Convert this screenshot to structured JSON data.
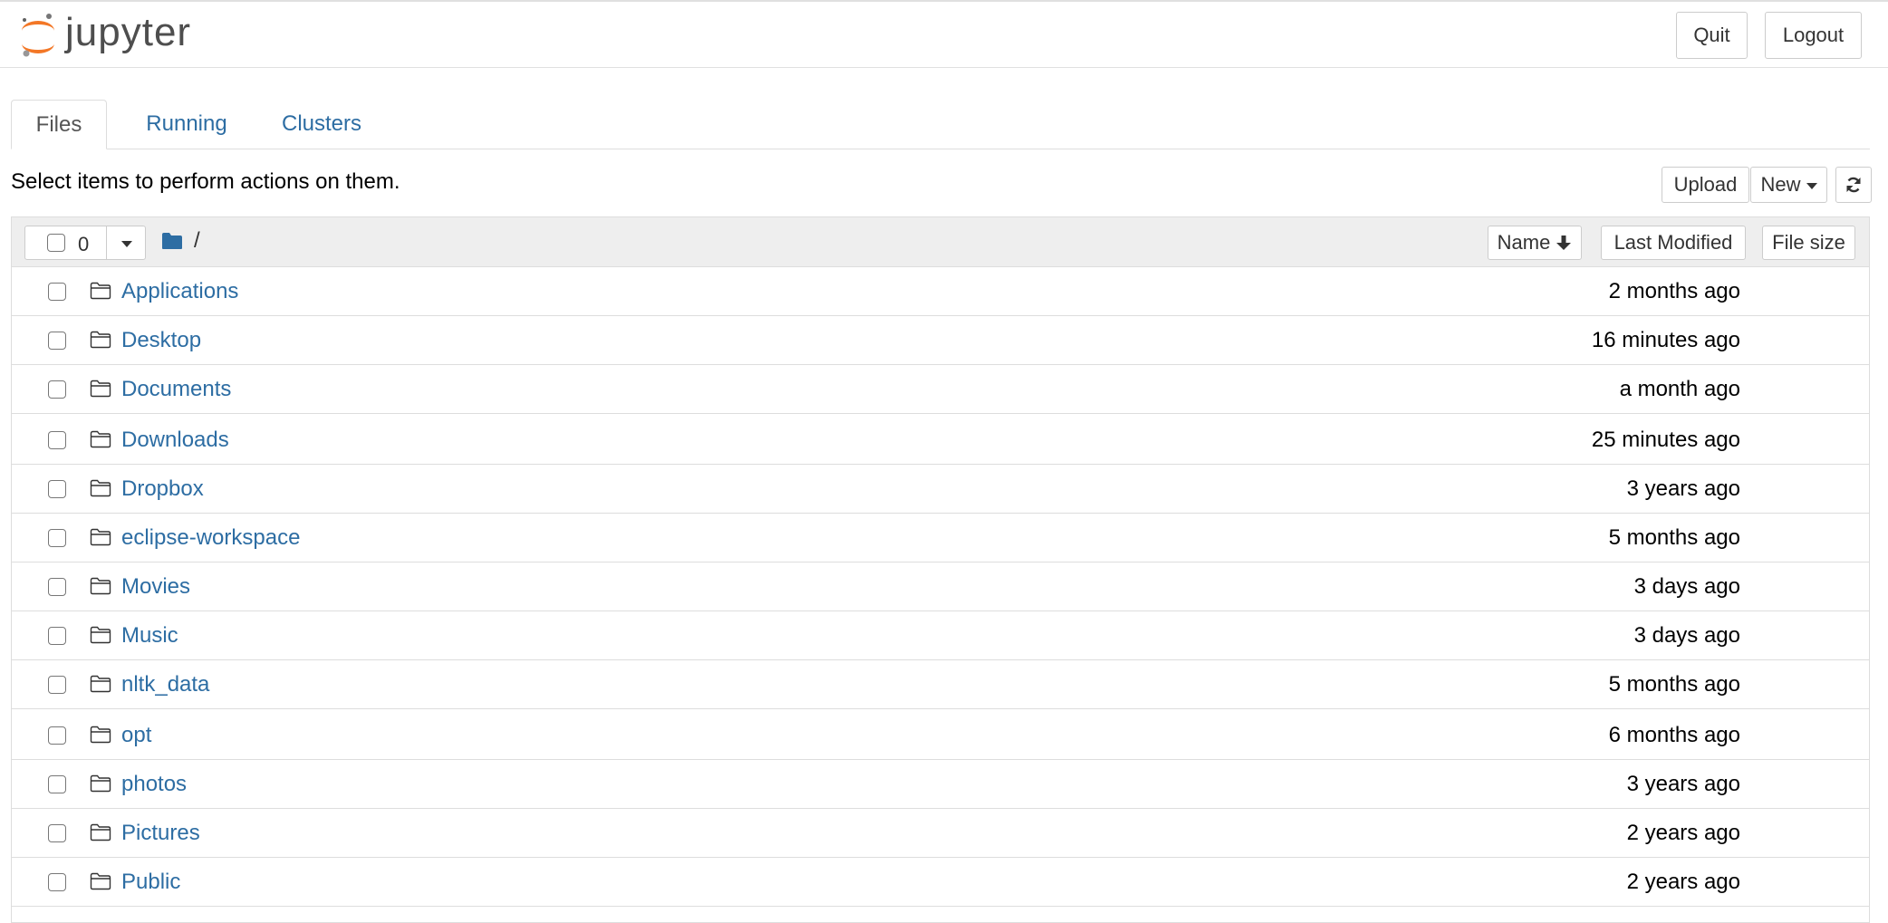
{
  "header": {
    "logo_text": "jupyter",
    "quit_label": "Quit",
    "logout_label": "Logout"
  },
  "tabs": [
    {
      "label": "Files",
      "active": true
    },
    {
      "label": "Running",
      "active": false
    },
    {
      "label": "Clusters",
      "active": false
    }
  ],
  "toolbar": {
    "instructions": "Select items to perform actions on them.",
    "upload_label": "Upload",
    "new_label": "New"
  },
  "list_header": {
    "selected_count": "0",
    "path": "/",
    "sort_name_label": "Name",
    "sort_modified_label": "Last Modified",
    "sort_size_label": "File size"
  },
  "files": [
    {
      "name": "Applications",
      "modified": "2 months ago"
    },
    {
      "name": "Desktop",
      "modified": "16 minutes ago"
    },
    {
      "name": "Documents",
      "modified": "a month ago"
    },
    {
      "name": "Downloads",
      "modified": "25 minutes ago"
    },
    {
      "name": "Dropbox",
      "modified": "3 years ago"
    },
    {
      "name": "eclipse-workspace",
      "modified": "5 months ago"
    },
    {
      "name": "Movies",
      "modified": "3 days ago"
    },
    {
      "name": "Music",
      "modified": "3 days ago"
    },
    {
      "name": "nltk_data",
      "modified": "5 months ago"
    },
    {
      "name": "opt",
      "modified": "6 months ago"
    },
    {
      "name": "photos",
      "modified": "3 years ago"
    },
    {
      "name": "Pictures",
      "modified": "2 years ago"
    },
    {
      "name": "Public",
      "modified": "2 years ago"
    }
  ],
  "colors": {
    "link": "#2d6da3",
    "logo_orange": "#f37726",
    "logo_gray": "#616161",
    "header_bg": "#eeeeee"
  }
}
